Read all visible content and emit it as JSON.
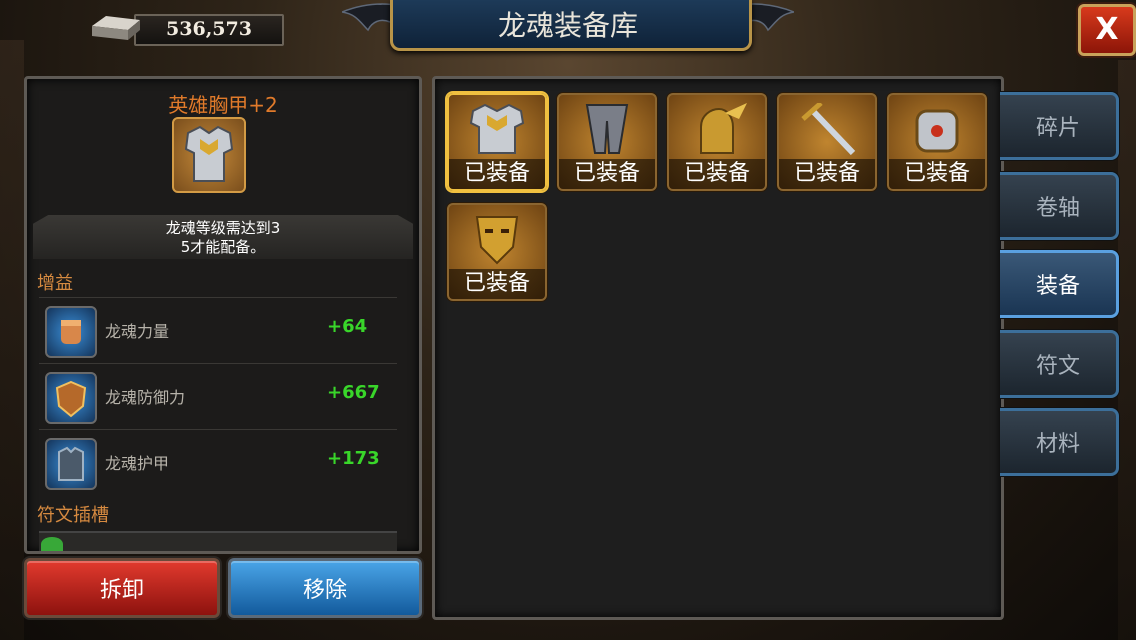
{
  "currency": {
    "amount": "536,573",
    "icon": "silver-ingot-icon"
  },
  "title": "龙魂装备库",
  "close_label": "X",
  "selected_item": {
    "name": "英雄胸甲+2",
    "icon": "chest-armor-icon",
    "requirement": [
      "龙魂等级需达到3",
      "5才能配备。"
    ]
  },
  "buffs": {
    "label": "增益",
    "stats": [
      {
        "name": "龙魂力量",
        "value": "+64",
        "icon": "fist-icon"
      },
      {
        "name": "龙魂防御力",
        "value": "+667",
        "icon": "shield-icon"
      },
      {
        "name": "龙魂护甲",
        "value": "+173",
        "icon": "armor-icon"
      }
    ]
  },
  "rune_slots_label": "符文插槽",
  "buttons": {
    "dismantle": "拆卸",
    "remove": "移除"
  },
  "inventory": [
    {
      "caption": "已装备",
      "icon": "chest-armor-icon",
      "selected": true
    },
    {
      "caption": "已装备",
      "icon": "leg-armor-icon",
      "selected": false
    },
    {
      "caption": "已装备",
      "icon": "winged-helmet-icon",
      "selected": false
    },
    {
      "caption": "已装备",
      "icon": "sword-icon",
      "selected": false
    },
    {
      "caption": "已装备",
      "icon": "gauntlet-icon",
      "selected": false
    },
    {
      "caption": "已装备",
      "icon": "golden-mask-icon",
      "selected": false
    }
  ],
  "tabs": [
    {
      "label": "碎片",
      "active": false
    },
    {
      "label": "卷轴",
      "active": false
    },
    {
      "label": "装备",
      "active": true
    },
    {
      "label": "符文",
      "active": false
    },
    {
      "label": "材料",
      "active": false
    }
  ]
}
